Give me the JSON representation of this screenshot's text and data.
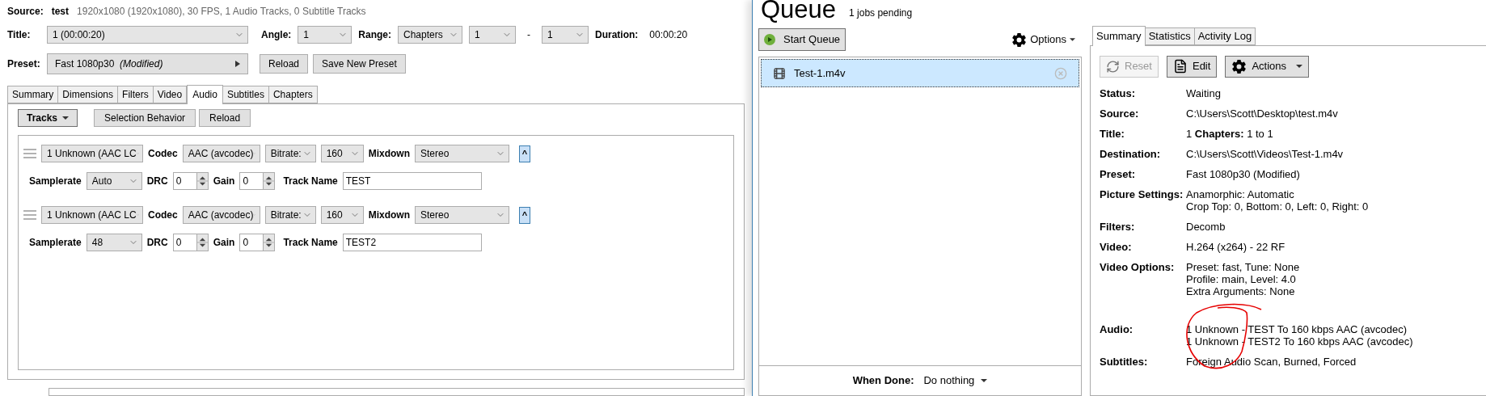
{
  "source": {
    "label": "Source:",
    "name": "test",
    "info": "1920x1080 (1920x1080), 30 FPS, 1 Audio Tracks, 0 Subtitle Tracks"
  },
  "title_row": {
    "label": "Title:",
    "title": "1  (00:00:20)",
    "angle_label": "Angle:",
    "angle": "1",
    "range_label": "Range:",
    "range": "Chapters",
    "from": "1",
    "dash": "-",
    "to": "1",
    "duration_label": "Duration:",
    "duration": "00:00:20"
  },
  "preset_row": {
    "label": "Preset:",
    "preset": "Fast 1080p30",
    "modified": "(Modified)",
    "buttons": [
      "Reload",
      "Save New Preset"
    ]
  },
  "tabs": [
    {
      "label": "Summary",
      "selected": false
    },
    {
      "label": "Dimensions",
      "selected": false
    },
    {
      "label": "Filters",
      "selected": false
    },
    {
      "label": "Video",
      "selected": false
    },
    {
      "label": "Audio",
      "selected": true
    },
    {
      "label": "Subtitles",
      "selected": false
    },
    {
      "label": "Chapters",
      "selected": false
    }
  ],
  "audio_toolbar": {
    "tracks": "Tracks",
    "buttons": [
      "Selection Behavior",
      "Reload"
    ]
  },
  "tracks": [
    {
      "source": "1 Unknown (AAC LC",
      "codec_label": "Codec",
      "codec": "AAC (avcodec)",
      "bitrate_mode": "Bitrate:",
      "bitrate": "160",
      "mixdown_label": "Mixdown",
      "mixdown": "Stereo",
      "collapse": "^",
      "samplerate_label": "Samplerate",
      "samplerate": "Auto",
      "drc_label": "DRC",
      "drc": "0",
      "gain_label": "Gain",
      "gain": "0",
      "track_name_label": "Track Name",
      "track_name": "TEST"
    },
    {
      "source": "1 Unknown (AAC LC",
      "codec_label": "Codec",
      "codec": "AAC (avcodec)",
      "bitrate_mode": "Bitrate:",
      "bitrate": "160",
      "mixdown_label": "Mixdown",
      "mixdown": "Stereo",
      "collapse": "^",
      "samplerate_label": "Samplerate",
      "samplerate": "48",
      "drc_label": "DRC",
      "drc": "0",
      "gain_label": "Gain",
      "gain": "0",
      "track_name_label": "Track Name",
      "track_name": "TEST2"
    }
  ],
  "queue": {
    "title": "Queue",
    "pending": "1 jobs pending",
    "start": "Start Queue",
    "options": "Options",
    "jobs": [
      {
        "name": "Test-1.m4v",
        "selected": true
      }
    ],
    "when_done_label": "When Done:",
    "when_done": "Do nothing"
  },
  "details": {
    "tabs": [
      {
        "label": "Summary",
        "selected": true
      },
      {
        "label": "Statistics",
        "selected": false
      },
      {
        "label": "Activity Log",
        "selected": false
      }
    ],
    "buttons": [
      {
        "kind": "reset",
        "label": "Reset",
        "disabled": true
      },
      {
        "kind": "edit",
        "label": "Edit",
        "disabled": false
      },
      {
        "kind": "actions",
        "label": "Actions",
        "disabled": false
      }
    ],
    "rows": [
      {
        "label": "Status:",
        "lines": [
          "Waiting"
        ]
      },
      {
        "label": "Source:",
        "lines": [
          "C:\\Users\\Scott\\Desktop\\test.m4v"
        ]
      },
      {
        "label": "Title:",
        "lines": [
          "1   **Chapters:** 1 to 1"
        ]
      },
      {
        "label": "Destination:",
        "lines": [
          "C:\\Users\\Scott\\Videos\\Test-1.m4v"
        ]
      },
      {
        "label": "Preset:",
        "lines": [
          "Fast 1080p30 (Modified)"
        ]
      },
      {
        "label": "Picture Settings:",
        "lines": [
          "Anamorphic: Automatic",
          "Crop Top: 0, Bottom: 0, Left: 0, Right: 0"
        ]
      },
      {
        "label": "Filters:",
        "lines": [
          "Decomb"
        ]
      },
      {
        "label": "Video:",
        "lines": [
          "H.264 (x264) - 22 RF"
        ]
      },
      {
        "label": "Video Options:",
        "lines": [
          "Preset: fast, Tune: None",
          "Profile: main, Level: 4.0",
          "Extra Arguments: None"
        ]
      },
      {
        "label": "Audio:",
        "lines": [
          "1 Unknown - TEST To 160 kbps AAC (avcodec)",
          "1 Unknown - TEST2 To 160 kbps AAC (avcodec)"
        ]
      },
      {
        "label": "Subtitles:",
        "lines": [
          "Foreign Audio Scan, Burned, Forced"
        ]
      }
    ]
  }
}
